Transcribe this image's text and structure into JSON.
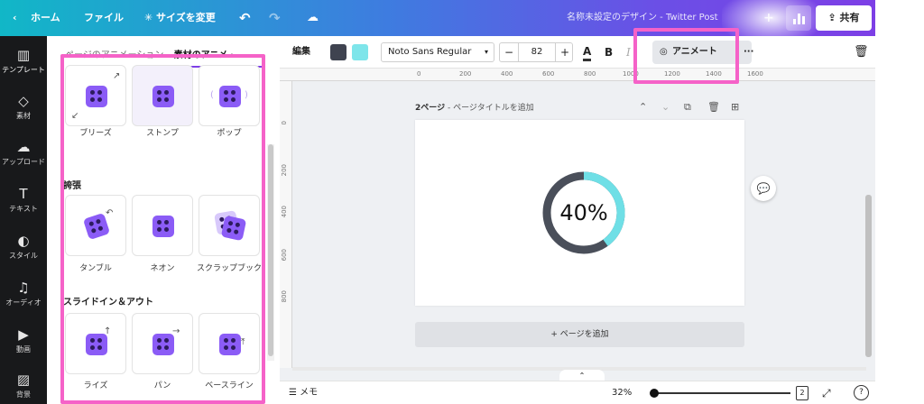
{
  "topbar": {
    "home": "ホーム",
    "file": "ファイル",
    "resize": "サイズを変更",
    "doc_title": "名称未設定のデザイン - Twitter Post",
    "share": "共有"
  },
  "rail": {
    "items": [
      {
        "label": "テンプレート",
        "icon": "template-icon"
      },
      {
        "label": "素材",
        "icon": "elements-icon"
      },
      {
        "label": "アップロード",
        "icon": "upload-icon"
      },
      {
        "label": "テキスト",
        "icon": "text-icon"
      },
      {
        "label": "スタイル",
        "icon": "palette-icon"
      },
      {
        "label": "オーディオ",
        "icon": "audio-icon"
      },
      {
        "label": "動画",
        "icon": "video-icon"
      },
      {
        "label": "背景",
        "icon": "background-icon"
      }
    ]
  },
  "panel": {
    "tab_page": "ページのアニメーション",
    "tab_element": "素材のアニメ",
    "sections": [
      "誇張",
      "スライドイン＆アウト"
    ],
    "row1": [
      "ブリーズ",
      "ストンプ",
      "ポップ"
    ],
    "row2": [
      "タンブル",
      "ネオン",
      "スクラップブック"
    ],
    "row3": [
      "ライズ",
      "パン",
      "ベースライン"
    ]
  },
  "toolbar": {
    "edit": "編集",
    "font": "Noto Sans Regular",
    "size": "82",
    "minus": "−",
    "plus": "+",
    "text_color": "A",
    "bold": "B",
    "italic": "I",
    "animate": "アニメート",
    "more": "···",
    "swatch_dark": "#3f4350",
    "swatch_light": "#7ee5ea"
  },
  "ruler": {
    "top": [
      "0",
      "200",
      "400",
      "600",
      "800",
      "1000",
      "1200",
      "1400",
      "1600"
    ],
    "left": [
      "0",
      "200",
      "400",
      "600",
      "800"
    ]
  },
  "canvas": {
    "page_num": "2ページ",
    "page_title": "ページタイトルを追加",
    "progress_percent": 40,
    "progress_label": "40%",
    "ring_color": "#4a4f5a",
    "ring_accent": "#6fdfe6",
    "add_page": "+ ページを追加"
  },
  "bottombar": {
    "notes": "メモ",
    "zoom": "32%",
    "pages": "2"
  }
}
